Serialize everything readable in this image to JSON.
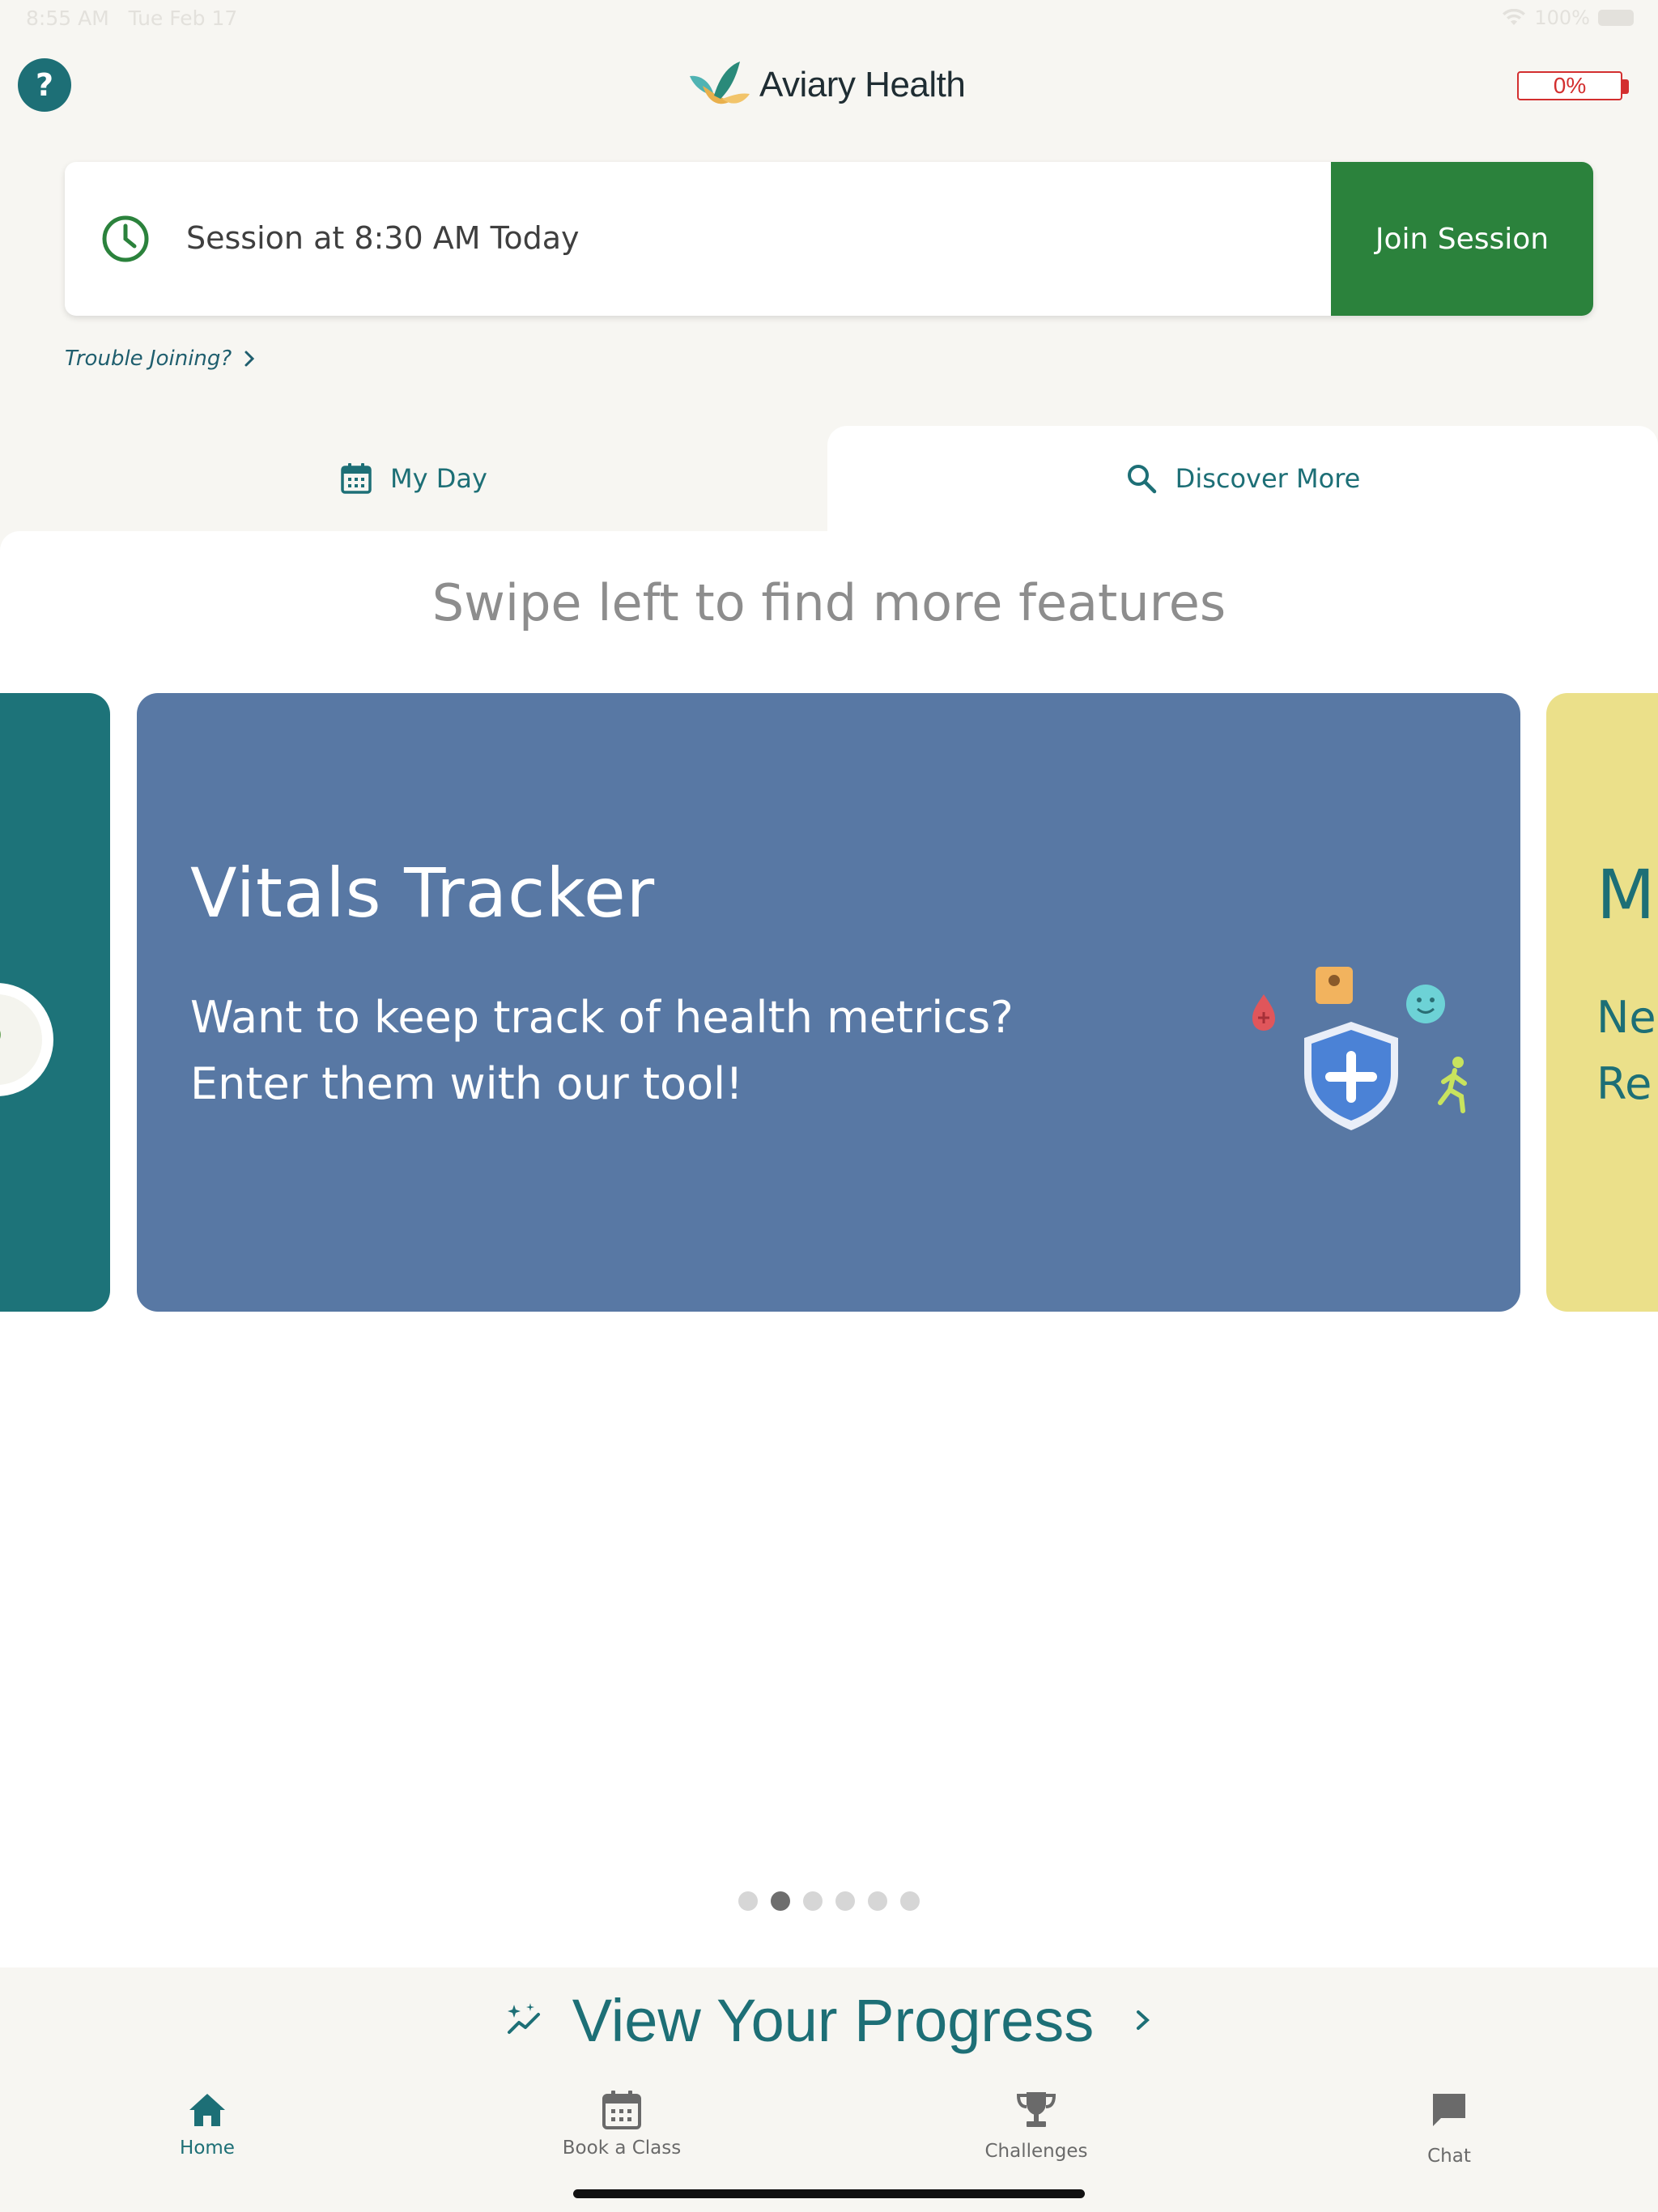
{
  "status_bar": {
    "time": "8:55 AM",
    "date": "Tue Feb 17",
    "battery": "100%"
  },
  "header": {
    "help_label": "?",
    "app_name": "Aviary Health",
    "battery_label": "0%"
  },
  "session": {
    "text": "Session at 8:30 AM Today",
    "join_label": "Join Session",
    "trouble_label": "Trouble Joining?"
  },
  "tabs": [
    {
      "label": "My Day",
      "icon": "calendar-icon",
      "selected": false
    },
    {
      "label": "Discover More",
      "icon": "search-icon",
      "selected": true
    }
  ],
  "discover": {
    "hint": "Swipe left to find more features",
    "current_card": {
      "title": "Vitals Tracker",
      "line1": "Want to keep track of health metrics?",
      "line2": "Enter them with our tool!"
    },
    "next_card": {
      "title": "M",
      "line1": "Ne",
      "line2": "Re"
    },
    "pager": {
      "count": 6,
      "active_index": 1
    }
  },
  "progress": {
    "label": "View Your Progress"
  },
  "nav": [
    {
      "label": "Home",
      "icon": "home-icon",
      "active": true
    },
    {
      "label": "Book a Class",
      "icon": "calendar-icon",
      "active": false
    },
    {
      "label": "Challenges",
      "icon": "trophy-icon",
      "active": false
    },
    {
      "label": "Chat",
      "icon": "chat-icon",
      "active": false
    }
  ],
  "colors": {
    "brand_teal": "#1d6f76",
    "join_green": "#2b823c",
    "card_blue": "#5878a4",
    "card_teal": "#1d7379",
    "card_yellow": "#ebe08a",
    "battery_red": "#d32f2f"
  }
}
